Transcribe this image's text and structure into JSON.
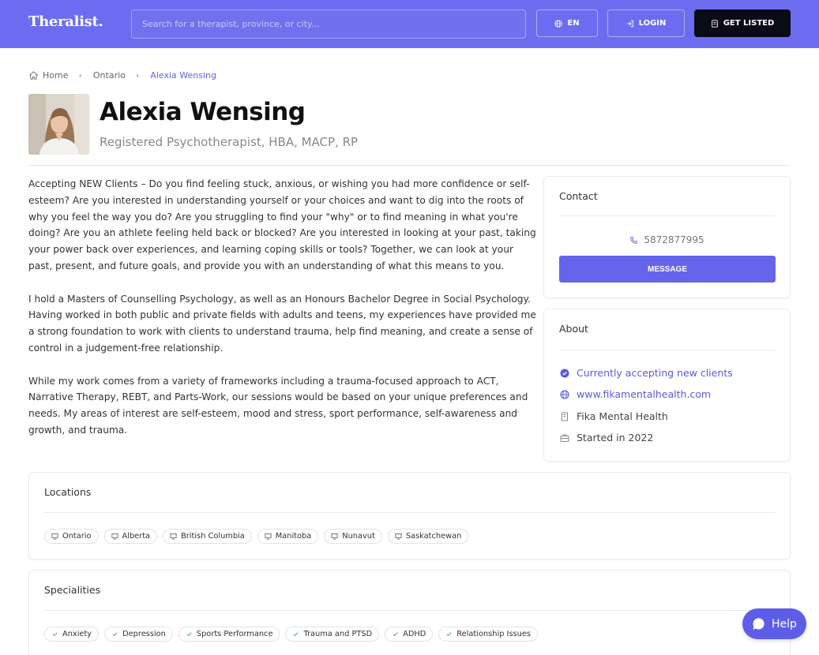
{
  "header": {
    "logo": "Theralist.",
    "search_placeholder": "Search for a therapist, province, or city...",
    "lang_label": "EN",
    "login_label": "LOGIN",
    "get_listed_label": "GET LISTED"
  },
  "breadcrumb": [
    "Home",
    "Ontario",
    "Alexia Wensing"
  ],
  "profile": {
    "name": "Alexia Wensing",
    "credentials": "Registered Psychotherapist, HBA, MACP, RP"
  },
  "bio": [
    "Accepting NEW Clients – Do you find feeling stuck, anxious, or wishing you had more confidence or self-esteem? Are you interested in understanding yourself or your choices and want to dig into the roots of why you feel the way you do? Are you struggling to find your \"why\" or to find meaning in what you're doing? Are you an athlete feeling held back or blocked? Are you interested in looking at your past, taking your power back over experiences, and learning coping skills or tools? Together, we can look at your past, present, and future goals, and provide you with an understanding of what this means to you.",
    "I hold a Masters of Counselling Psychology, as well as an Honours Bachelor Degree in Social Psychology. Having worked in both public and private fields with adults and teens, my experiences have provided me a strong foundation to work with clients to understand trauma, help find meaning, and create a sense of control in a judgement-free relationship.",
    "While my work comes from a variety of frameworks including a trauma-focused approach to ACT, Narrative Therapy, REBT, and Parts-Work, our sessions would be based on your unique preferences and needs. My areas of interest are self-esteem, mood and stress, sport performance, self-awareness and growth, and trauma."
  ],
  "contact": {
    "title": "Contact",
    "phone": "5872877995",
    "message_label": "MESSAGE"
  },
  "about": {
    "title": "About",
    "accepting": "Currently accepting new clients",
    "website": "www.fikamentalhealth.com",
    "practice": "Fika Mental Health",
    "started": "Started in 2022"
  },
  "locations": {
    "title": "Locations",
    "items": [
      "Ontario",
      "Alberta",
      "British Columbia",
      "Manitoba",
      "Nunavut",
      "Saskatchewan"
    ]
  },
  "specialities": {
    "title": "Specialities",
    "items": [
      "Anxiety",
      "Depression",
      "Sports Performance",
      "Trauma and PTSD",
      "ADHD",
      "Relationship Issues"
    ]
  },
  "help_label": "Help",
  "colors": {
    "header": "#6c6cf0",
    "accent": "#6565ec",
    "dark_button": "#0b0b18"
  }
}
